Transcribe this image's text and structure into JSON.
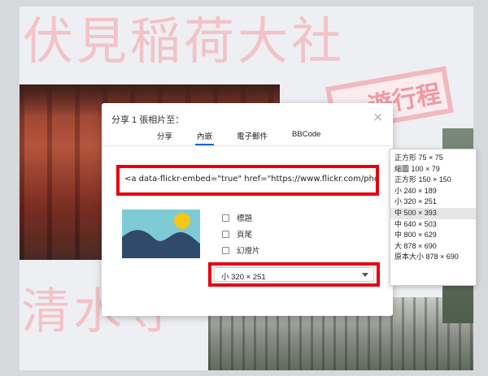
{
  "background": {
    "title_top": "伏見稲荷大社",
    "title_bottom": "清水寺",
    "stamp_text": "遊行程"
  },
  "modal": {
    "title": "分享 1 張相片至：",
    "close_symbol": "×",
    "tabs": [
      {
        "label": "分享",
        "active": false
      },
      {
        "label": "內嵌",
        "active": true
      },
      {
        "label": "電子郵件",
        "active": false
      },
      {
        "label": "BBCode",
        "active": false
      }
    ],
    "embed_code": "<a data-flickr-embed=\"true\"  href=\"https://www.flickr.com/photos/",
    "options": [
      {
        "label": "標題",
        "checked": false
      },
      {
        "label": "頁尾",
        "checked": false
      },
      {
        "label": "幻燈片",
        "checked": false
      }
    ],
    "size_select": {
      "value": "小 320 × 251"
    }
  },
  "dropdown": {
    "items": [
      "正方形 75 × 75",
      "縮圖 100 × 79",
      "正方形 150 × 150",
      "小 240 × 189",
      "小 320 × 251",
      "中 500 × 393",
      "中 640 × 503",
      "中 800 × 629",
      "大 878 × 690",
      "原本大小 878 × 690"
    ],
    "highlighted_index": 5
  },
  "colors": {
    "highlight_red": "#e60012",
    "active_tab": "#0063dc",
    "thumb_sky": "#7ecbd6",
    "thumb_mountain": "#2f4a6b",
    "thumb_sun": "#f5c518"
  }
}
